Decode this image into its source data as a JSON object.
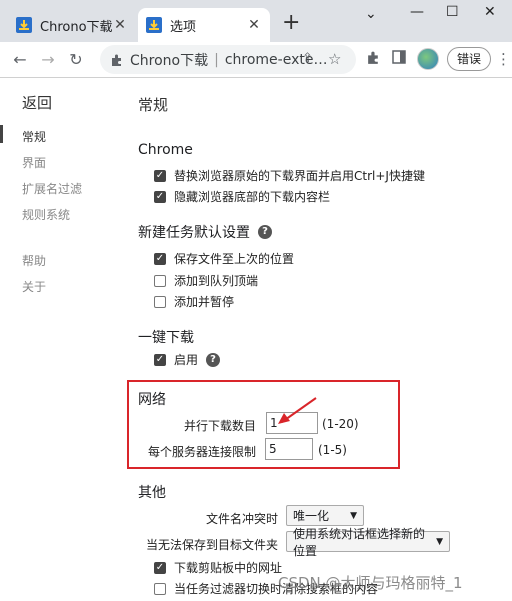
{
  "tabs": [
    {
      "title": "Chrono下载管理",
      "icon": "download-icon"
    },
    {
      "title": "选项",
      "icon": "download-icon"
    }
  ],
  "toolbar": {
    "url_part1": "Chrono下载",
    "url_separator": "|",
    "url_part2": "chrome-exte…",
    "profile_button": "错误"
  },
  "sidebar": {
    "back": "返回",
    "items": [
      "常规",
      "界面",
      "扩展名过滤",
      "规则系统"
    ],
    "items2": [
      "帮助",
      "关于"
    ]
  },
  "content": {
    "page_title": "常规",
    "chrome": {
      "heading": "Chrome",
      "options": [
        {
          "label": "替换浏览器原始的下载界面并启用Ctrl+J快捷键",
          "checked": true
        },
        {
          "label": "隐藏浏览器底部的下载内容栏",
          "checked": true
        }
      ]
    },
    "new_task": {
      "heading": "新建任务默认设置",
      "options": [
        {
          "label": "保存文件至上次的位置",
          "checked": true
        },
        {
          "label": "添加到队列顶端",
          "checked": false
        },
        {
          "label": "添加并暂停",
          "checked": false
        }
      ]
    },
    "one_click": {
      "heading": "一键下载",
      "enable_label": "启用",
      "checked": true
    },
    "network": {
      "heading": "网络",
      "parallel_label": "并行下载数目",
      "parallel_value": "1",
      "parallel_range": "(1-20)",
      "server_label": "每个服务器连接限制",
      "server_value": "5",
      "server_range": "(1-5)"
    },
    "other": {
      "heading": "其他",
      "conflict_label": "文件名冲突时",
      "conflict_value": "唯一化",
      "save_fail_label": "当无法保存到目标文件夹",
      "save_fail_value": "使用系统对话框选择新的位置",
      "options": [
        {
          "label": "下载剪贴板中的网址",
          "checked": true
        },
        {
          "label": "当任务过滤器切换时清除搜索框的内容",
          "checked": false
        }
      ]
    }
  },
  "watermark": "CSDN @大师与玛格丽特_1",
  "colors": {
    "highlight_box": "#d9252a",
    "arrow": "#d9252a"
  }
}
